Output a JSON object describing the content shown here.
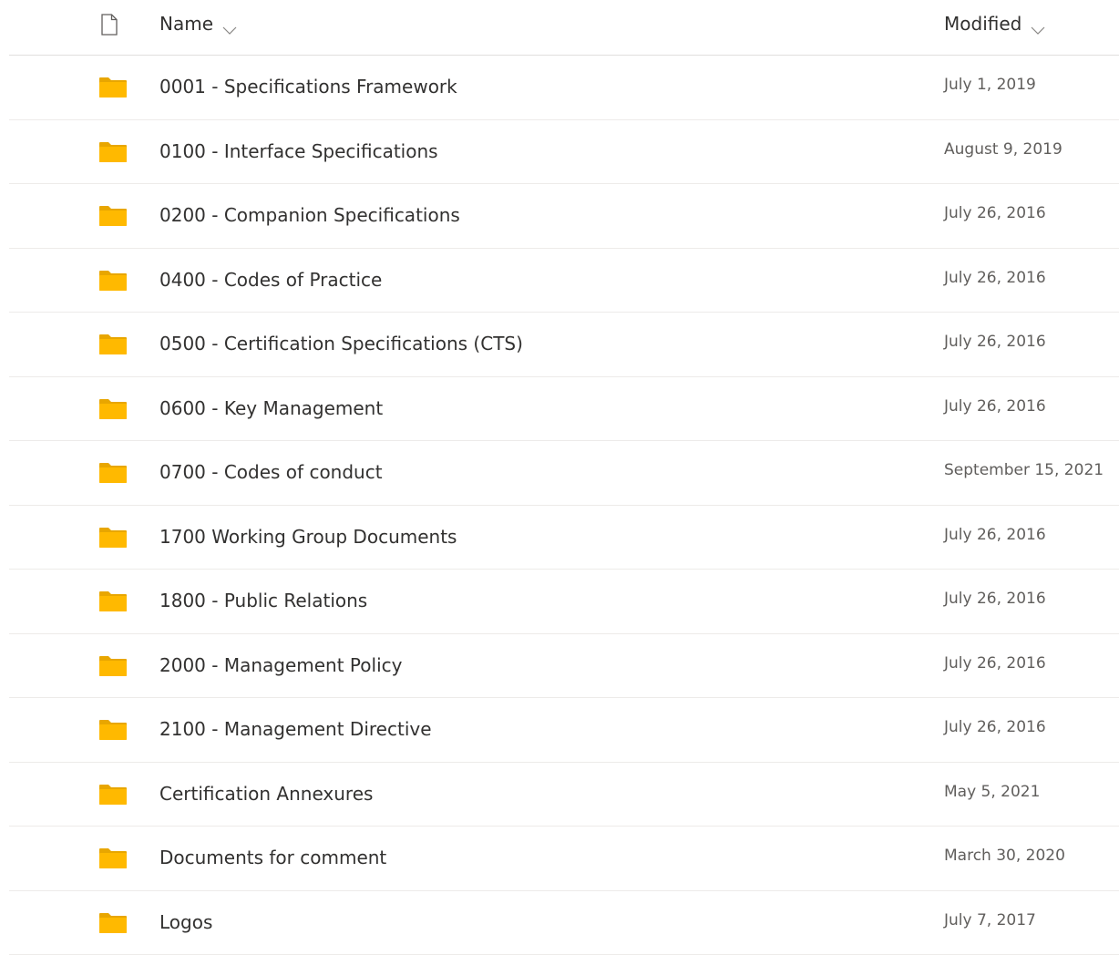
{
  "columns": {
    "name_label": "Name",
    "modified_label": "Modified",
    "file_type_icon": "document-icon",
    "sort_icon": "chevron-down-icon"
  },
  "items": [
    {
      "name": "0001 - Specifications Framework",
      "modified": "July 1, 2019",
      "icon": "folder-icon"
    },
    {
      "name": "0100 - Interface Specifications",
      "modified": "August 9, 2019",
      "icon": "folder-icon"
    },
    {
      "name": "0200 - Companion Specifications",
      "modified": "July 26, 2016",
      "icon": "folder-icon"
    },
    {
      "name": "0400 - Codes of Practice",
      "modified": "July 26, 2016",
      "icon": "folder-icon"
    },
    {
      "name": "0500 - Certification Specifications (CTS)",
      "modified": "July 26, 2016",
      "icon": "folder-icon"
    },
    {
      "name": "0600 - Key Management",
      "modified": "July 26, 2016",
      "icon": "folder-icon"
    },
    {
      "name": "0700 - Codes of conduct",
      "modified": "September 15, 2021",
      "icon": "folder-icon"
    },
    {
      "name": "1700 Working Group Documents",
      "modified": "July 26, 2016",
      "icon": "folder-icon"
    },
    {
      "name": "1800 - Public Relations",
      "modified": "July 26, 2016",
      "icon": "folder-icon"
    },
    {
      "name": "2000 - Management Policy",
      "modified": "July 26, 2016",
      "icon": "folder-icon"
    },
    {
      "name": "2100 - Management Directive",
      "modified": "July 26, 2016",
      "icon": "folder-icon"
    },
    {
      "name": "Certification Annexures",
      "modified": "May 5, 2021",
      "icon": "folder-icon"
    },
    {
      "name": "Documents for comment",
      "modified": "March 30, 2020",
      "icon": "folder-icon"
    },
    {
      "name": "Logos",
      "modified": "July 7, 2017",
      "icon": "folder-icon"
    }
  ],
  "colors": {
    "folder": "#FFB900",
    "folder_tab": "#E8A600",
    "text_primary": "#323130",
    "text_secondary": "#605e5c",
    "divider": "#edebe9"
  }
}
